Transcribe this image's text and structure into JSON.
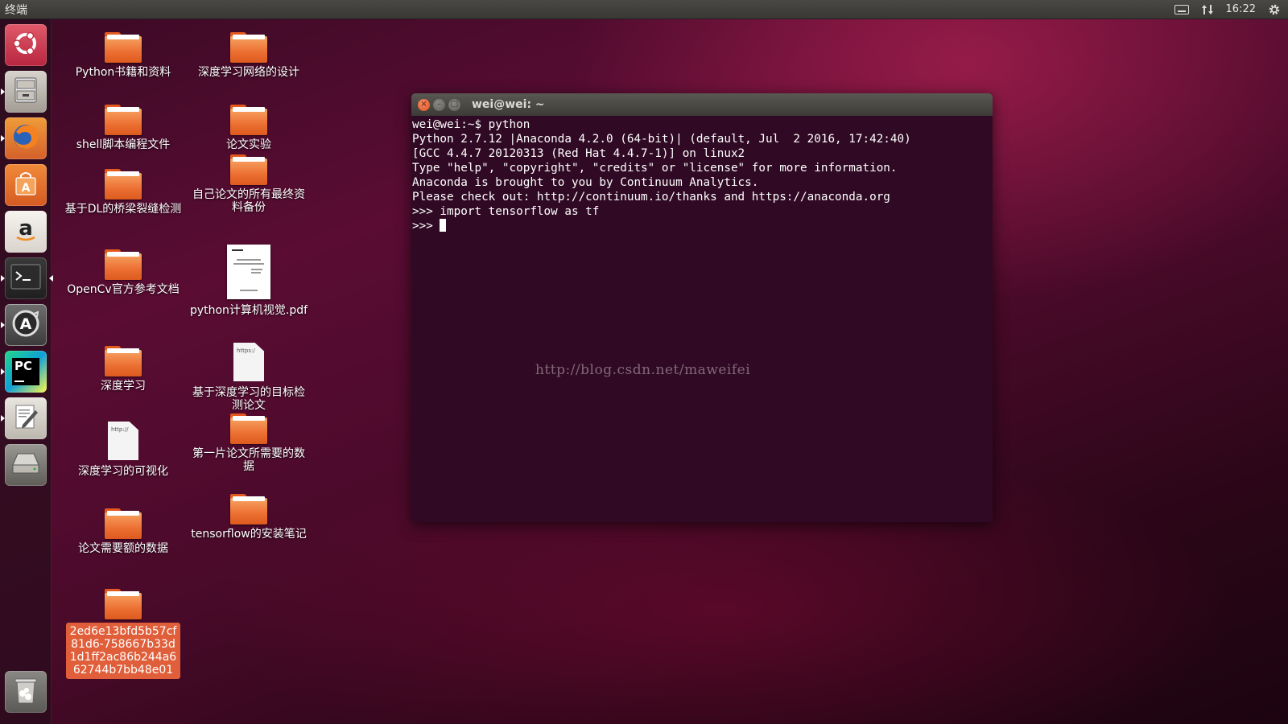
{
  "top_panel": {
    "app_title": "终端",
    "clock": "16:22",
    "icons": [
      "keyboard-icon",
      "network-updown-icon",
      "gear-icon"
    ]
  },
  "launcher": {
    "items": [
      {
        "name": "dash-home",
        "icon": "ubuntu-logo-icon"
      },
      {
        "name": "files",
        "icon": "file-cabinet-icon"
      },
      {
        "name": "firefox",
        "icon": "firefox-icon"
      },
      {
        "name": "software-center",
        "icon": "shopping-bag-icon"
      },
      {
        "name": "amazon",
        "icon": "amazon-icon"
      },
      {
        "name": "terminal",
        "icon": "terminal-icon"
      },
      {
        "name": "software-updater",
        "icon": "updater-icon"
      },
      {
        "name": "pycharm",
        "icon": "pycharm-icon"
      },
      {
        "name": "text-editor",
        "icon": "text-editor-icon"
      },
      {
        "name": "disk",
        "icon": "disk-drive-icon"
      },
      {
        "name": "trash",
        "icon": "trash-icon"
      }
    ],
    "pycharm_text": "PC"
  },
  "desktop": {
    "icons": [
      {
        "label": "Python书籍和资料",
        "type": "folder"
      },
      {
        "label": "shell脚本编程文件",
        "type": "folder"
      },
      {
        "label": "基于DL的桥梁裂缝检测",
        "type": "folder"
      },
      {
        "label": "OpenCv官方参考文档",
        "type": "folder"
      },
      {
        "label": "深度学习",
        "type": "folder"
      },
      {
        "label": "深度学习的可视化",
        "type": "document",
        "thumb_text": "http://"
      },
      {
        "label": "论文需要额的数据",
        "type": "folder"
      },
      {
        "label": "2ed6e13bfd5b57cf81d6-758667b33d1d1ff2ac86b244a662744b7bb48e01",
        "type": "folder",
        "selected": true
      },
      {
        "label": "深度学习网络的设计",
        "type": "folder"
      },
      {
        "label": "论文实验",
        "type": "folder"
      },
      {
        "label": "自己论文的所有最终资料备份",
        "type": "folder"
      },
      {
        "label": "python计算机视觉.pdf",
        "type": "pdf"
      },
      {
        "label": "基于深度学习的目标检测论文",
        "type": "document",
        "thumb_text": "https:/"
      },
      {
        "label": "第一片论文所需要的数据",
        "type": "folder"
      },
      {
        "label": "tensorflow的安装笔记",
        "type": "folder"
      }
    ]
  },
  "terminal": {
    "title": "wei@wei: ~",
    "close_glyph": "×",
    "min_glyph": "–",
    "max_glyph": "□",
    "lines": [
      "wei@wei:~$ python",
      "Python 2.7.12 |Anaconda 4.2.0 (64-bit)| (default, Jul  2 2016, 17:42:40)",
      "[GCC 4.4.7 20120313 (Red Hat 4.4.7-1)] on linux2",
      "Type \"help\", \"copyright\", \"credits\" or \"license\" for more information.",
      "Anaconda is brought to you by Continuum Analytics.",
      "Please check out: http://continuum.io/thanks and https://anaconda.org",
      ">>> import tensorflow as tf",
      ">>> "
    ]
  },
  "watermark": "http://blog.csdn.net/maweifei",
  "colors": {
    "terminal_bg": "#300a24",
    "folder_orange": "#ec6f32",
    "selection": "#e05f3a",
    "panel": "#3c3b37"
  }
}
